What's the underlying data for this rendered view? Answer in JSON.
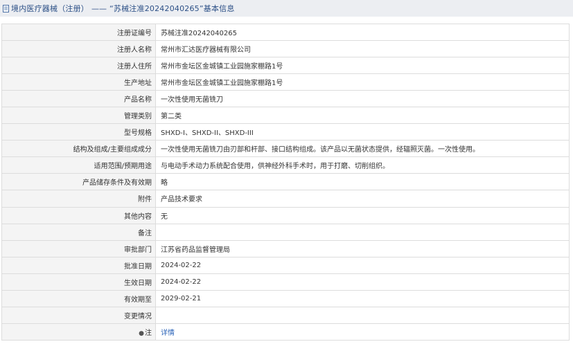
{
  "header": {
    "section": "境内医疗器械（注册）",
    "separator": "——",
    "record_title": "“苏械注准20242040265”基本信息"
  },
  "rows": [
    {
      "label": "注册证编号",
      "value": "苏械注准20242040265"
    },
    {
      "label": "注册人名称",
      "value": "常州市汇达医疗器械有限公司"
    },
    {
      "label": "注册人住所",
      "value": "常州市金坛区金城镇工业园施家棚路1号"
    },
    {
      "label": "生产地址",
      "value": "常州市金坛区金城镇工业园施家棚路1号"
    },
    {
      "label": "产品名称",
      "value": "一次性使用无菌铣刀"
    },
    {
      "label": "管理类别",
      "value": "第二类"
    },
    {
      "label": "型号规格",
      "value": "SHXD-I、SHXD-II、SHXD-III"
    },
    {
      "label": "结构及组成/主要组成成分",
      "value": "一次性使用无菌铣刀由刃部和杆部、接口结构组成。该产品以无菌状态提供，经辐照灭菌。一次性使用。"
    },
    {
      "label": "适用范围/预期用途",
      "value": "与电动手术动力系统配合使用，供神经外科手术时，用于打磨、切削组织。"
    },
    {
      "label": "产品储存条件及有效期",
      "value": "略"
    },
    {
      "label": "附件",
      "value": "产品技术要求"
    },
    {
      "label": "其他内容",
      "value": "无"
    },
    {
      "label": "备注",
      "value": ""
    },
    {
      "label": "审批部门",
      "value": "江苏省药品监督管理局"
    },
    {
      "label": "批准日期",
      "value": "2024-02-22"
    },
    {
      "label": "生效日期",
      "value": "2024-02-22"
    },
    {
      "label": "有效期至",
      "value": "2029-02-21"
    },
    {
      "label": "变更情况",
      "value": ""
    }
  ],
  "note_row": {
    "icon": "pin-icon",
    "label": "注",
    "link_text": "详情"
  }
}
